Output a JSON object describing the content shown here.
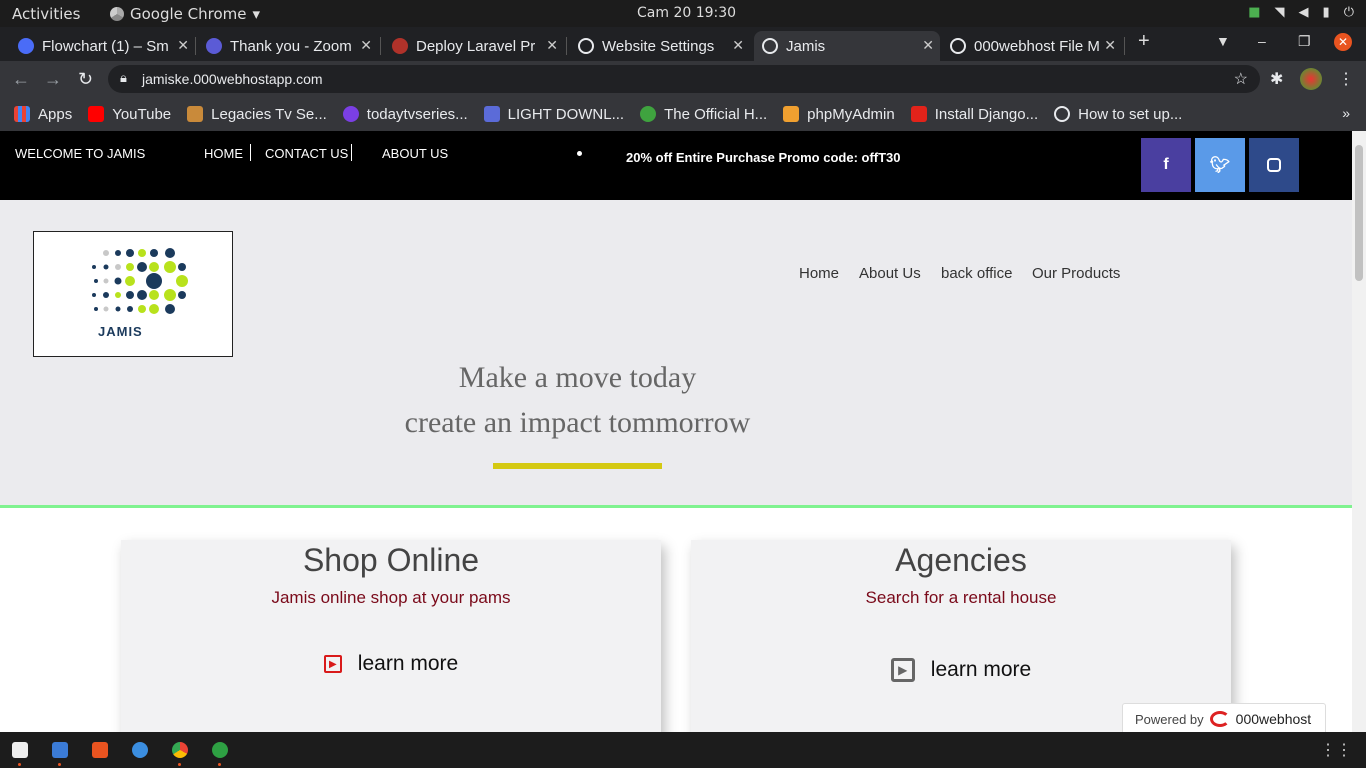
{
  "system_bar": {
    "activities": "Activities",
    "app_name": "Google Chrome",
    "clock": "Cam 20  19:30"
  },
  "tabs": [
    {
      "label": "Flowchart (1) – Sm",
      "color": "#4a6cf7"
    },
    {
      "label": "Thank you - Zoom",
      "color": "#5b5bd6"
    },
    {
      "label": "Deploy Laravel Pr",
      "color": "#b0322a"
    },
    {
      "label": "Website Settings",
      "color": "#e8eaed"
    },
    {
      "label": "Jamis",
      "color": "#e8eaed"
    },
    {
      "label": "000webhost File M",
      "color": "#e8eaed"
    }
  ],
  "address_bar": {
    "url": "jamiske.000webhostapp.com"
  },
  "bookmarks": [
    {
      "label": "Apps",
      "color": "#ea4335"
    },
    {
      "label": "YouTube",
      "color": "#ff0000"
    },
    {
      "label": "Legacies Tv Se...",
      "color": "#c98a3a"
    },
    {
      "label": "todaytvseries...",
      "color": "#7b3fe4"
    },
    {
      "label": "LIGHT DOWNL...",
      "color": "#5b6bd8"
    },
    {
      "label": "The Official H...",
      "color": "#3fa33f"
    },
    {
      "label": "phpMyAdmin",
      "color": "#f0a030"
    },
    {
      "label": "Install Django...",
      "color": "#e2231a"
    },
    {
      "label": "How to set up...",
      "color": "#e8eaed"
    }
  ],
  "site": {
    "welcome": "WELCOME TO JAMIS",
    "top_links": [
      "HOME",
      "CONTACT US",
      "ABOUT US"
    ],
    "promo": "20% off Entire Purchase Promo code: offT30",
    "social": [
      {
        "icon": "f",
        "color": "#4a3fa0"
      },
      {
        "icon": "t",
        "color": "#5a9ae8"
      },
      {
        "icon": "ig",
        "color": "#2e4a8a"
      }
    ],
    "logo_text": "JAMIS",
    "main_nav": [
      "Home",
      "About Us",
      "back office",
      "Our Products"
    ],
    "tagline_1": "Make a move today",
    "tagline_2": "create an impact tommorrow",
    "cards": [
      {
        "title": "Shop Online",
        "subtitle": "Jamis online shop at your pams",
        "link": "learn more",
        "icon_color": "#d91a1a"
      },
      {
        "title": "Agencies",
        "subtitle": "Search for a rental house",
        "link": "learn more",
        "icon_color": "#666"
      }
    ],
    "powered_by": "Powered by",
    "powered_brand": "000webhost"
  }
}
